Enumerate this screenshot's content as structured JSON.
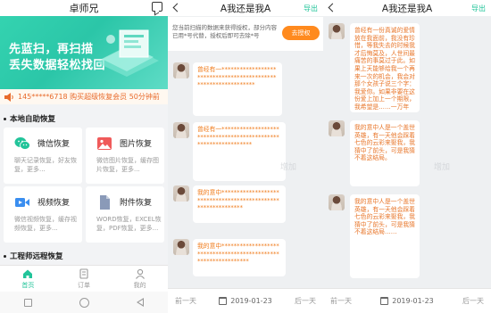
{
  "panel1": {
    "title": "卓师兄",
    "banner": {
      "line1": "先蓝扫，再扫描",
      "line2": "丢失数据轻松找回"
    },
    "notice": "145*****6718 购买超级恢复会员  50分钟前",
    "section_local": "本地自助恢复",
    "section_remote": "工程师远程恢复",
    "cards": [
      {
        "title": "微信恢复",
        "desc": "聊天记录恢复，好友恢复，更多...",
        "icon": "wechat-icon",
        "color": "#22c49a"
      },
      {
        "title": "图片恢复",
        "desc": "微信图片恢复，缓存图片恢复，更多...",
        "icon": "image-icon",
        "color": "#f05a5a"
      },
      {
        "title": "视频恢复",
        "desc": "微信视频恢复，缓存视频恢复，更多...",
        "icon": "video-icon",
        "color": "#3a8ef0"
      },
      {
        "title": "附件恢复",
        "desc": "WORD恢复，EXCEL恢复，PDF恢复，更多...",
        "icon": "file-icon",
        "color": "#8a9ab8"
      }
    ],
    "tabs": [
      {
        "label": "首页",
        "icon": "home-icon"
      },
      {
        "label": "订单",
        "icon": "order-icon"
      },
      {
        "label": "我的",
        "icon": "user-icon"
      }
    ]
  },
  "panel2": {
    "title": "A我还是我A",
    "export": "导出",
    "auth_text": "您当前扫描的数据来获得授权，部分内容已用*号代替，授权后即可去除*号",
    "auth_button": "去授权",
    "messages": [
      "曾经有一***************************************************************",
      "曾经有一****************************************************************",
      "我的意中*************************************************************",
      "我的意中***************************************************************"
    ],
    "watermark": "增加",
    "footer": {
      "prev": "前一天",
      "date": "2019-01-23",
      "next": "后一天"
    }
  },
  "panel3": {
    "title": "A我还是我A",
    "export": "导出",
    "messages": [
      "曾经有一份真诚的爱情放在我面前，我没有珍惜，等我失去的时候我才后悔莫及，人世间最痛苦的事莫过于此。如果上天能够给我一个再来一次的机会，我会对那个女孩子说三个字：我爱你。如果非要在这份爱上加上一个期限，我希望是……一万年",
      "我的意中人是一个盖世英雄，有一天他会踩着七色的云彩来娶我，我猜中了前头，可是我猜不着这结局。",
      "我的意中人是一个盖世英雄，有一天他会踩着七色的云彩来娶我，我猜中了前头，可是我猜不着这结局……"
    ],
    "watermark": "增加",
    "footer": {
      "prev": "前一天",
      "date": "2019-01-23",
      "next": "后一天"
    }
  }
}
